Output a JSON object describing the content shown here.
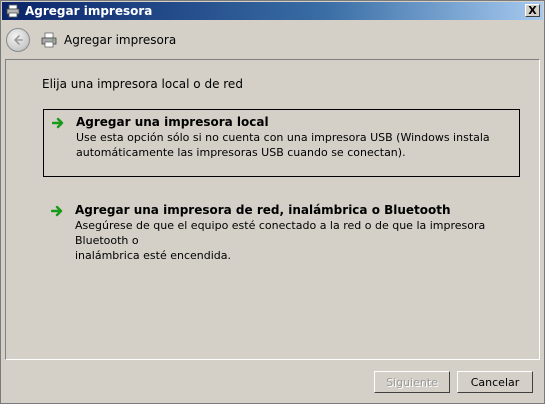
{
  "window": {
    "title": "Agregar impresora",
    "close_label": "X"
  },
  "nav": {
    "title": "Agregar impresora"
  },
  "content": {
    "heading": "Elija una impresora local o de red",
    "options": [
      {
        "title": "Agregar una impresora local",
        "description_line1": "Use esta opción sólo si no cuenta con una impresora USB (Windows instala",
        "description_line2": "automáticamente las impresoras USB cuando se conectan)."
      },
      {
        "title": "Agregar una impresora de red, inalámbrica o Bluetooth",
        "description_line1": "Asegúrese de que el equipo esté conectado a la red o de que la impresora Bluetooth o",
        "description_line2": "inalámbrica esté encendida."
      }
    ]
  },
  "footer": {
    "next_label": "Siguiente",
    "cancel_label": "Cancelar"
  },
  "colors": {
    "arrow_green": "#1a9a1a",
    "title_bar": "#0a246a"
  }
}
